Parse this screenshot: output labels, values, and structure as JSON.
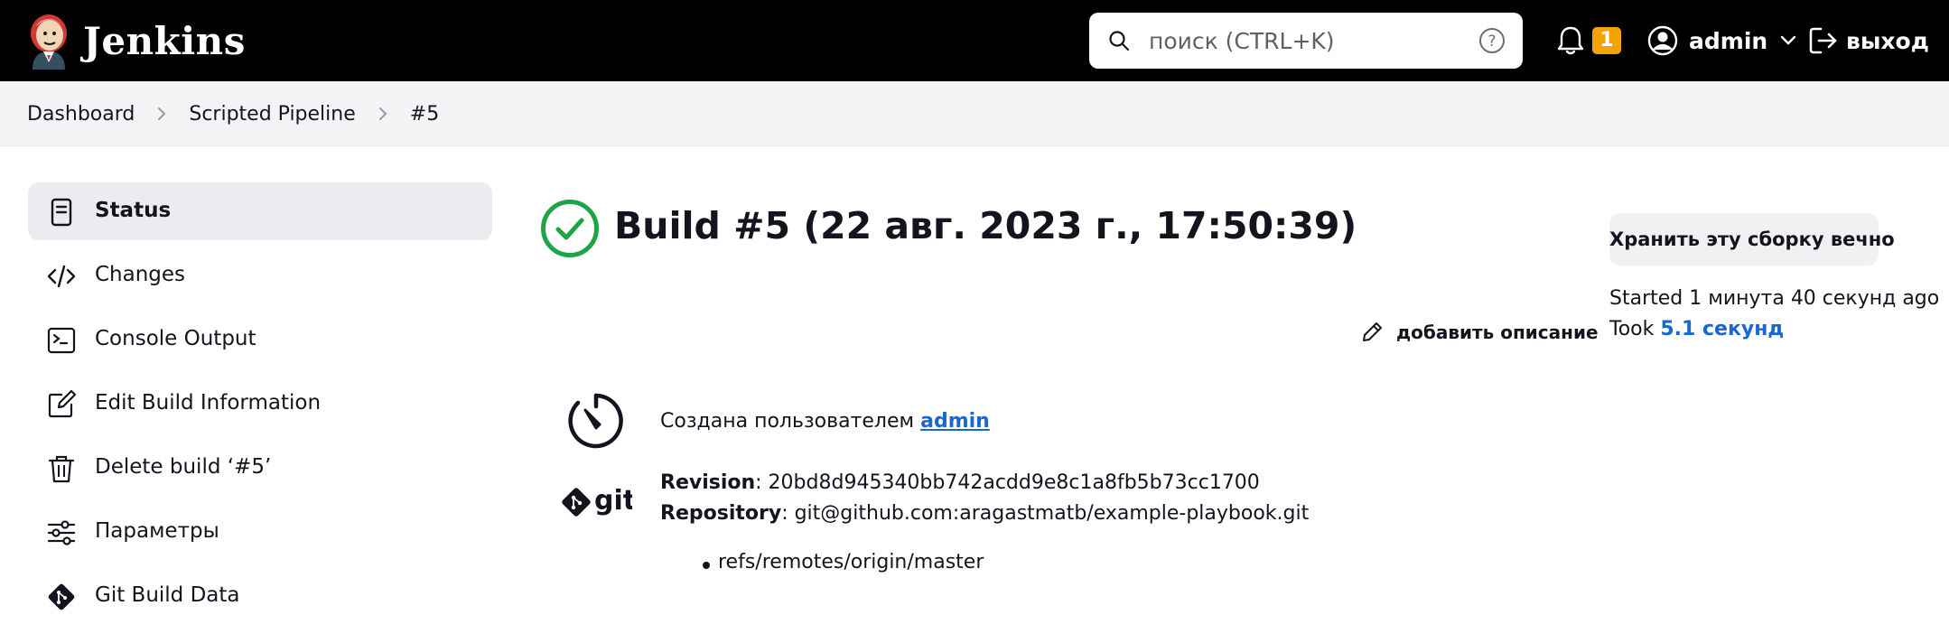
{
  "header": {
    "brand": "Jenkins",
    "search_placeholder": "поиск (CTRL+K)",
    "notification_count": "1",
    "user_name": "admin",
    "logout_label": "выход"
  },
  "breadcrumb": [
    "Dashboard",
    "Scripted Pipeline",
    "#5"
  ],
  "sidebar": {
    "items": [
      {
        "label": "Status",
        "icon": "document-icon",
        "active": true
      },
      {
        "label": "Changes",
        "icon": "code-icon"
      },
      {
        "label": "Console Output",
        "icon": "terminal-icon"
      },
      {
        "label": "Edit Build Information",
        "icon": "edit-icon"
      },
      {
        "label": "Delete build ‘#5’",
        "icon": "trash-icon"
      },
      {
        "label": "Параметры",
        "icon": "sliders-icon"
      },
      {
        "label": "Git Build Data",
        "icon": "git-icon"
      }
    ]
  },
  "build": {
    "title": "Build #5 (22 авг. 2023 г., 17:50:39)",
    "keep_forever_label": "Хранить эту сборку вечно",
    "started": "Started 1 минута 40 секунд ago",
    "took_prefix": "Took ",
    "took_value": "5.1 секунд",
    "add_description_label": "добавить описание",
    "created_by_prefix": "Создана пользователем ",
    "created_by_user": "admin",
    "revision_label": "Revision",
    "revision_value": ": 20bd8d945340bb742acdd9e8c1a8fb5b73cc1700",
    "repository_label": "Repository",
    "repository_value": ": git@github.com:aragastmatb/example-playbook.git",
    "refs": [
      "refs/remotes/origin/master"
    ]
  },
  "colors": {
    "header_bg": "#000000",
    "badge": "#f5a300",
    "link": "#1a67d1",
    "success": "#1ea446",
    "active_item_bg": "#ececf0"
  }
}
